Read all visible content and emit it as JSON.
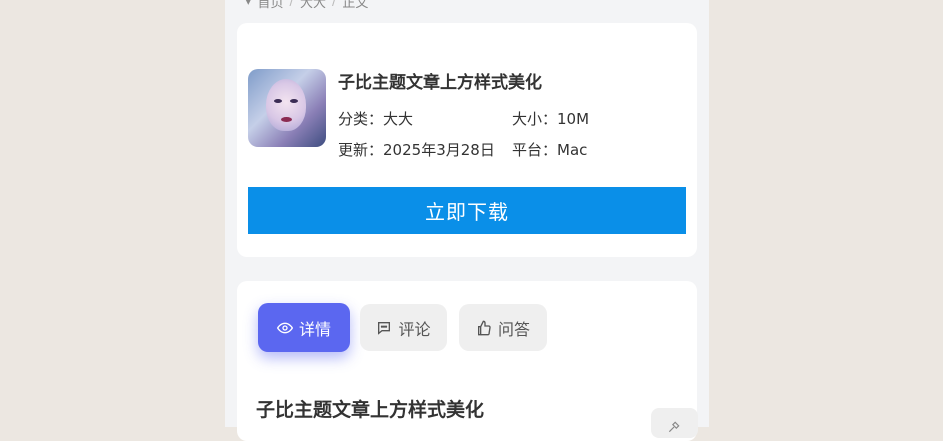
{
  "breadcrumb": {
    "items": [
      "首页",
      "大大",
      "正文"
    ]
  },
  "app": {
    "title": "子比主题文章上方样式美化",
    "category_label": "分类：",
    "category": "大大",
    "size_label": "大小：",
    "size": "10M",
    "updated_label": "更新：",
    "updated": "2025年3月28日",
    "platform_label": "平台：",
    "platform": "Mac",
    "download_label": "立即下载"
  },
  "tabs": [
    {
      "label": "详情",
      "icon": "eye-icon",
      "active": true
    },
    {
      "label": "评论",
      "icon": "comment-icon",
      "active": false
    },
    {
      "label": "问答",
      "icon": "thumbs-up-icon",
      "active": false
    }
  ],
  "detail": {
    "title": "子比主题文章上方样式美化"
  },
  "colors": {
    "accent": "#5b67f0",
    "download": "#0a8fe8"
  }
}
